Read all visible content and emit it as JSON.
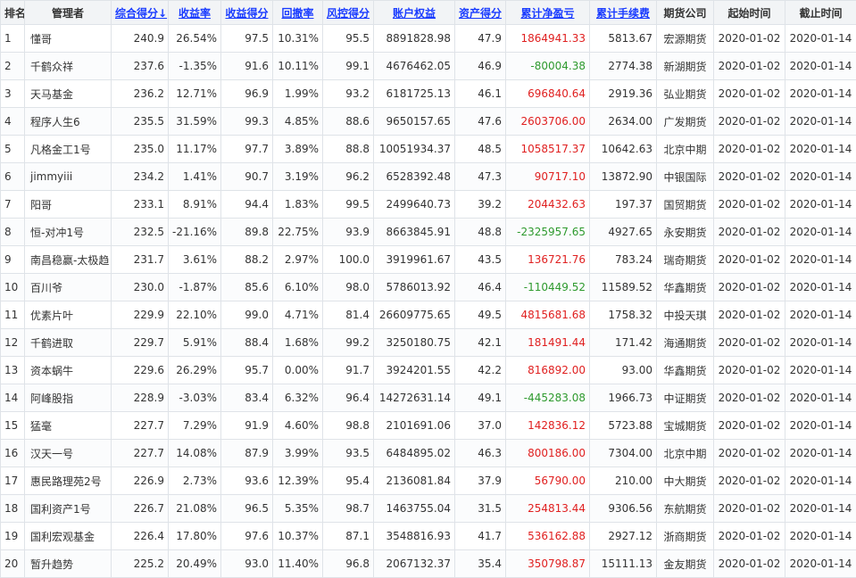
{
  "table": {
    "headers": [
      "排名",
      "管理者",
      "综合得分↓",
      "收益率",
      "收益得分",
      "回撤率",
      "风控得分",
      "账户权益",
      "资产得分",
      "累计净盈亏",
      "累计手续费",
      "期货公司",
      "起始时间",
      "截止时间"
    ],
    "sortable": [
      false,
      false,
      true,
      true,
      true,
      true,
      true,
      true,
      true,
      true,
      true,
      false,
      false,
      false
    ],
    "rows": [
      {
        "rank": "1",
        "name": "懂哥",
        "score": "240.9",
        "ret": "26.54%",
        "ret_score": "97.5",
        "dd": "10.31%",
        "risk_score": "95.5",
        "equity": "8891828.98",
        "asset_score": "47.9",
        "pnl": "1864941.33",
        "pnl_sign": "pos",
        "fee": "5813.67",
        "broker": "宏源期货",
        "start": "2020-01-02",
        "end": "2020-01-14"
      },
      {
        "rank": "2",
        "name": "千鹤众祥",
        "score": "237.6",
        "ret": "-1.35%",
        "ret_score": "91.6",
        "dd": "10.11%",
        "risk_score": "99.1",
        "equity": "4676462.05",
        "asset_score": "46.9",
        "pnl": "-80004.38",
        "pnl_sign": "neg",
        "fee": "2774.38",
        "broker": "新湖期货",
        "start": "2020-01-02",
        "end": "2020-01-14"
      },
      {
        "rank": "3",
        "name": "天马基金",
        "score": "236.2",
        "ret": "12.71%",
        "ret_score": "96.9",
        "dd": "1.99%",
        "risk_score": "93.2",
        "equity": "6181725.13",
        "asset_score": "46.1",
        "pnl": "696840.64",
        "pnl_sign": "pos",
        "fee": "2919.36",
        "broker": "弘业期货",
        "start": "2020-01-02",
        "end": "2020-01-14"
      },
      {
        "rank": "4",
        "name": "程序人生6",
        "score": "235.5",
        "ret": "31.59%",
        "ret_score": "99.3",
        "dd": "4.85%",
        "risk_score": "88.6",
        "equity": "9650157.65",
        "asset_score": "47.6",
        "pnl": "2603706.00",
        "pnl_sign": "pos",
        "fee": "2634.00",
        "broker": "广发期货",
        "start": "2020-01-02",
        "end": "2020-01-14"
      },
      {
        "rank": "5",
        "name": "凡格金工1号",
        "score": "235.0",
        "ret": "11.17%",
        "ret_score": "97.7",
        "dd": "3.89%",
        "risk_score": "88.8",
        "equity": "10051934.37",
        "asset_score": "48.5",
        "pnl": "1058517.37",
        "pnl_sign": "pos",
        "fee": "10642.63",
        "broker": "北京中期",
        "start": "2020-01-02",
        "end": "2020-01-14"
      },
      {
        "rank": "6",
        "name": "jimmyiii",
        "score": "234.2",
        "ret": "1.41%",
        "ret_score": "90.7",
        "dd": "3.19%",
        "risk_score": "96.2",
        "equity": "6528392.48",
        "asset_score": "47.3",
        "pnl": "90717.10",
        "pnl_sign": "pos",
        "fee": "13872.90",
        "broker": "中银国际",
        "start": "2020-01-02",
        "end": "2020-01-14"
      },
      {
        "rank": "7",
        "name": "阳哥",
        "score": "233.1",
        "ret": "8.91%",
        "ret_score": "94.4",
        "dd": "1.83%",
        "risk_score": "99.5",
        "equity": "2499640.73",
        "asset_score": "39.2",
        "pnl": "204432.63",
        "pnl_sign": "pos",
        "fee": "197.37",
        "broker": "国贸期货",
        "start": "2020-01-02",
        "end": "2020-01-14"
      },
      {
        "rank": "8",
        "name": "恒-对冲1号",
        "score": "232.5",
        "ret": "-21.16%",
        "ret_score": "89.8",
        "dd": "22.75%",
        "risk_score": "93.9",
        "equity": "8663845.91",
        "asset_score": "48.8",
        "pnl": "-2325957.65",
        "pnl_sign": "neg",
        "fee": "4927.65",
        "broker": "永安期货",
        "start": "2020-01-02",
        "end": "2020-01-14"
      },
      {
        "rank": "9",
        "name": "南昌稳赢-太极趋",
        "score": "231.7",
        "ret": "3.61%",
        "ret_score": "88.2",
        "dd": "2.97%",
        "risk_score": "100.0",
        "equity": "3919961.67",
        "asset_score": "43.5",
        "pnl": "136721.76",
        "pnl_sign": "pos",
        "fee": "783.24",
        "broker": "瑞奇期货",
        "start": "2020-01-02",
        "end": "2020-01-14"
      },
      {
        "rank": "10",
        "name": "百川爷",
        "score": "230.0",
        "ret": "-1.87%",
        "ret_score": "85.6",
        "dd": "6.10%",
        "risk_score": "98.0",
        "equity": "5786013.92",
        "asset_score": "46.4",
        "pnl": "-110449.52",
        "pnl_sign": "neg",
        "fee": "11589.52",
        "broker": "华鑫期货",
        "start": "2020-01-02",
        "end": "2020-01-14"
      },
      {
        "rank": "11",
        "name": "优素片叶",
        "score": "229.9",
        "ret": "22.10%",
        "ret_score": "99.0",
        "dd": "4.71%",
        "risk_score": "81.4",
        "equity": "26609775.65",
        "asset_score": "49.5",
        "pnl": "4815681.68",
        "pnl_sign": "pos",
        "fee": "1758.32",
        "broker": "中投天琪",
        "start": "2020-01-02",
        "end": "2020-01-14"
      },
      {
        "rank": "12",
        "name": "千鹤进取",
        "score": "229.7",
        "ret": "5.91%",
        "ret_score": "88.4",
        "dd": "1.68%",
        "risk_score": "99.2",
        "equity": "3250180.75",
        "asset_score": "42.1",
        "pnl": "181491.44",
        "pnl_sign": "pos",
        "fee": "171.42",
        "broker": "海通期货",
        "start": "2020-01-02",
        "end": "2020-01-14"
      },
      {
        "rank": "13",
        "name": "资本蜗牛",
        "score": "229.6",
        "ret": "26.29%",
        "ret_score": "95.7",
        "dd": "0.00%",
        "risk_score": "91.7",
        "equity": "3924201.55",
        "asset_score": "42.2",
        "pnl": "816892.00",
        "pnl_sign": "pos",
        "fee": "93.00",
        "broker": "华鑫期货",
        "start": "2020-01-02",
        "end": "2020-01-14"
      },
      {
        "rank": "14",
        "name": "阿峰股指",
        "score": "228.9",
        "ret": "-3.03%",
        "ret_score": "83.4",
        "dd": "6.32%",
        "risk_score": "96.4",
        "equity": "14272631.14",
        "asset_score": "49.1",
        "pnl": "-445283.08",
        "pnl_sign": "neg",
        "fee": "1966.73",
        "broker": "中证期货",
        "start": "2020-01-02",
        "end": "2020-01-14"
      },
      {
        "rank": "15",
        "name": "猛毫",
        "score": "227.7",
        "ret": "7.29%",
        "ret_score": "91.9",
        "dd": "4.60%",
        "risk_score": "98.8",
        "equity": "2101691.06",
        "asset_score": "37.0",
        "pnl": "142836.12",
        "pnl_sign": "pos",
        "fee": "5723.88",
        "broker": "宝城期货",
        "start": "2020-01-02",
        "end": "2020-01-14"
      },
      {
        "rank": "16",
        "name": "汉天一号",
        "score": "227.7",
        "ret": "14.08%",
        "ret_score": "87.9",
        "dd": "3.99%",
        "risk_score": "93.5",
        "equity": "6484895.02",
        "asset_score": "46.3",
        "pnl": "800186.00",
        "pnl_sign": "pos",
        "fee": "7304.00",
        "broker": "北京中期",
        "start": "2020-01-02",
        "end": "2020-01-14"
      },
      {
        "rank": "17",
        "name": "惠民路理苑2号",
        "score": "226.9",
        "ret": "2.73%",
        "ret_score": "93.6",
        "dd": "12.39%",
        "risk_score": "95.4",
        "equity": "2136081.84",
        "asset_score": "37.9",
        "pnl": "56790.00",
        "pnl_sign": "pos",
        "fee": "210.00",
        "broker": "中大期货",
        "start": "2020-01-02",
        "end": "2020-01-14"
      },
      {
        "rank": "18",
        "name": "国利资产1号",
        "score": "226.7",
        "ret": "21.08%",
        "ret_score": "96.5",
        "dd": "5.35%",
        "risk_score": "98.7",
        "equity": "1463755.04",
        "asset_score": "31.5",
        "pnl": "254813.44",
        "pnl_sign": "pos",
        "fee": "9306.56",
        "broker": "东航期货",
        "start": "2020-01-02",
        "end": "2020-01-14"
      },
      {
        "rank": "19",
        "name": "国利宏观基金",
        "score": "226.4",
        "ret": "17.80%",
        "ret_score": "97.6",
        "dd": "10.37%",
        "risk_score": "87.1",
        "equity": "3548816.93",
        "asset_score": "41.7",
        "pnl": "536162.88",
        "pnl_sign": "pos",
        "fee": "2927.12",
        "broker": "浙商期货",
        "start": "2020-01-02",
        "end": "2020-01-14"
      },
      {
        "rank": "20",
        "name": "暂升趋势",
        "score": "225.2",
        "ret": "20.49%",
        "ret_score": "93.0",
        "dd": "11.40%",
        "risk_score": "96.8",
        "equity": "2067132.37",
        "asset_score": "35.4",
        "pnl": "350798.87",
        "pnl_sign": "pos",
        "fee": "15111.13",
        "broker": "金友期货",
        "start": "2020-01-02",
        "end": "2020-01-14"
      }
    ]
  }
}
